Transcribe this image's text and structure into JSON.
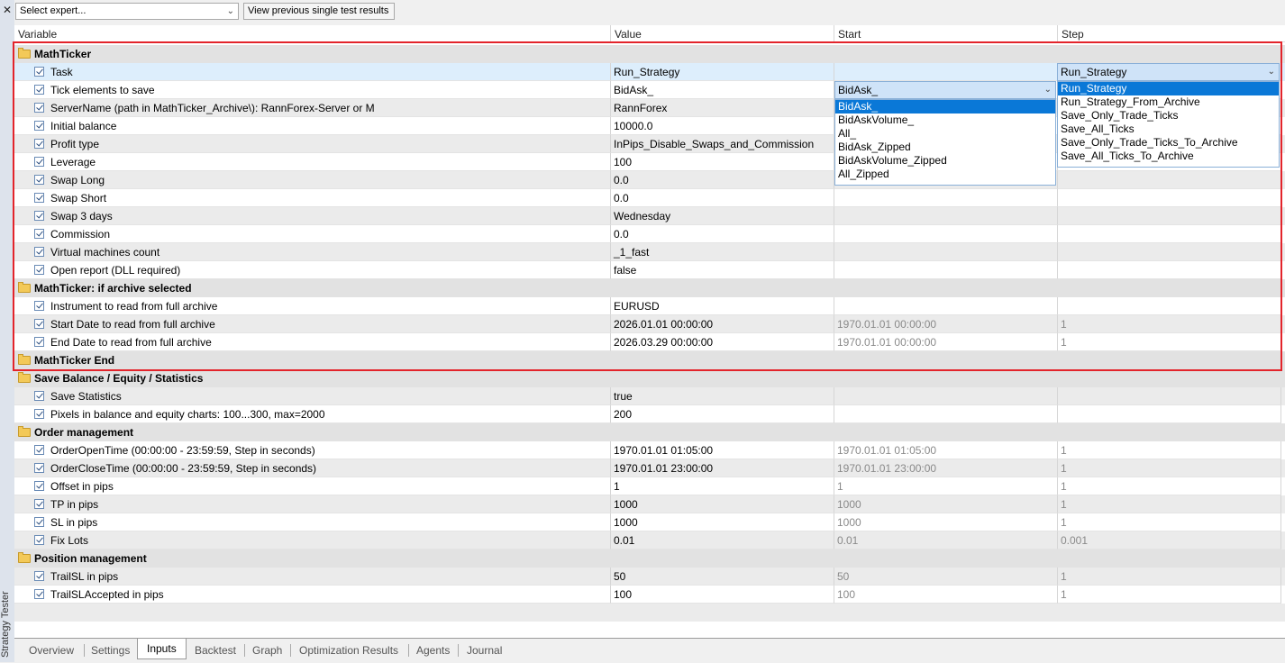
{
  "side": {
    "close": "✕",
    "label": "Strategy Tester"
  },
  "toolbar": {
    "expert_placeholder": "Select expert...",
    "view_prev": "View previous single test results"
  },
  "columns": [
    "Variable",
    "Value",
    "Start",
    "Step"
  ],
  "groups": {
    "g1": "MathTicker",
    "g2": "MathTicker: if archive selected",
    "g3": "MathTicker End",
    "g4": "Save Balance / Equity / Statistics",
    "g5": "Order management",
    "g6": "Position management"
  },
  "rows": {
    "task": {
      "name": "Task",
      "value": "Run_Strategy",
      "start": "",
      "step": ""
    },
    "tick": {
      "name": "Tick elements to save",
      "value": "BidAsk_",
      "start": "",
      "step": ""
    },
    "server": {
      "name": "ServerName (path in MathTicker_Archive\\): RannForex-Server or M",
      "value": "RannForex",
      "start": "",
      "step": ""
    },
    "balance": {
      "name": "Initial balance",
      "value": "10000.0",
      "start": "",
      "step": ""
    },
    "profit": {
      "name": "Profit type",
      "value": "InPips_Disable_Swaps_and_Commission",
      "start": "",
      "step": ""
    },
    "leverage": {
      "name": "Leverage",
      "value": "100",
      "start": "",
      "step": ""
    },
    "swaplong": {
      "name": "Swap Long",
      "value": "0.0",
      "start": "",
      "step": ""
    },
    "swapshort": {
      "name": "Swap Short",
      "value": "0.0",
      "start": "",
      "step": ""
    },
    "swap3": {
      "name": "Swap 3 days",
      "value": "Wednesday",
      "start": "",
      "step": ""
    },
    "commission": {
      "name": "Commission",
      "value": "0.0",
      "start": "",
      "step": ""
    },
    "vm": {
      "name": "Virtual machines count",
      "value": "_1_fast",
      "start": "",
      "step": ""
    },
    "report": {
      "name": "Open report (DLL required)",
      "value": "false",
      "start": "",
      "step": ""
    },
    "instrument": {
      "name": "Instrument to read from full archive",
      "value": "EURUSD",
      "start": "",
      "step": ""
    },
    "startdate": {
      "name": "Start Date to read from full archive",
      "value": "2026.01.01 00:00:00",
      "start": "1970.01.01 00:00:00",
      "step": "1"
    },
    "enddate": {
      "name": "End Date to read from full archive",
      "value": "2026.03.29 00:00:00",
      "start": "1970.01.01 00:00:00",
      "step": "1"
    },
    "savestats": {
      "name": "Save Statistics",
      "value": "true",
      "start": "",
      "step": ""
    },
    "pixels": {
      "name": "Pixels in balance and equity charts: 100...300, max=2000",
      "value": "200",
      "start": "",
      "step": ""
    },
    "opentime": {
      "name": "OrderOpenTime  (00:00:00 - 23:59:59, Step in seconds)",
      "value": "1970.01.01 01:05:00",
      "start": "1970.01.01 01:05:00",
      "step": "1"
    },
    "closetime": {
      "name": "OrderCloseTime (00:00:00 - 23:59:59, Step in seconds)",
      "value": "1970.01.01 23:00:00",
      "start": "1970.01.01 23:00:00",
      "step": "1"
    },
    "offset": {
      "name": "Offset in pips",
      "value": "1",
      "start": "1",
      "step": "1"
    },
    "tp": {
      "name": "TP in pips",
      "value": "1000",
      "start": "1000",
      "step": "1"
    },
    "sl": {
      "name": "SL in pips",
      "value": "1000",
      "start": "1000",
      "step": "1"
    },
    "fixlots": {
      "name": "Fix Lots",
      "value": "0.01",
      "start": "0.01",
      "step": "0.001"
    },
    "trailsl": {
      "name": "TrailSL in pips",
      "value": "50",
      "start": "50",
      "step": "1"
    },
    "trailacc": {
      "name": "TrailSLAccepted in pips",
      "value": "100",
      "start": "100",
      "step": "1"
    }
  },
  "dropdown_tick": {
    "selected": "BidAsk_",
    "options": [
      "BidAsk_",
      "BidAskVolume_",
      "All_",
      "BidAsk_Zipped",
      "BidAskVolume_Zipped",
      "All_Zipped"
    ]
  },
  "dropdown_task": {
    "selected": "Run_Strategy",
    "options": [
      "Run_Strategy",
      "Run_Strategy_From_Archive",
      "Save_Only_Trade_Ticks",
      "Save_All_Ticks",
      "Save_Only_Trade_Ticks_To_Archive",
      "Save_All_Ticks_To_Archive"
    ]
  },
  "tabs": [
    "Overview",
    "Settings",
    "Inputs",
    "Backtest",
    "Graph",
    "Optimization Results",
    "Agents",
    "Journal"
  ],
  "active_tab": "Inputs",
  "colors": {
    "highlight_frame": "#e3242b",
    "selection": "#0a78d7"
  }
}
